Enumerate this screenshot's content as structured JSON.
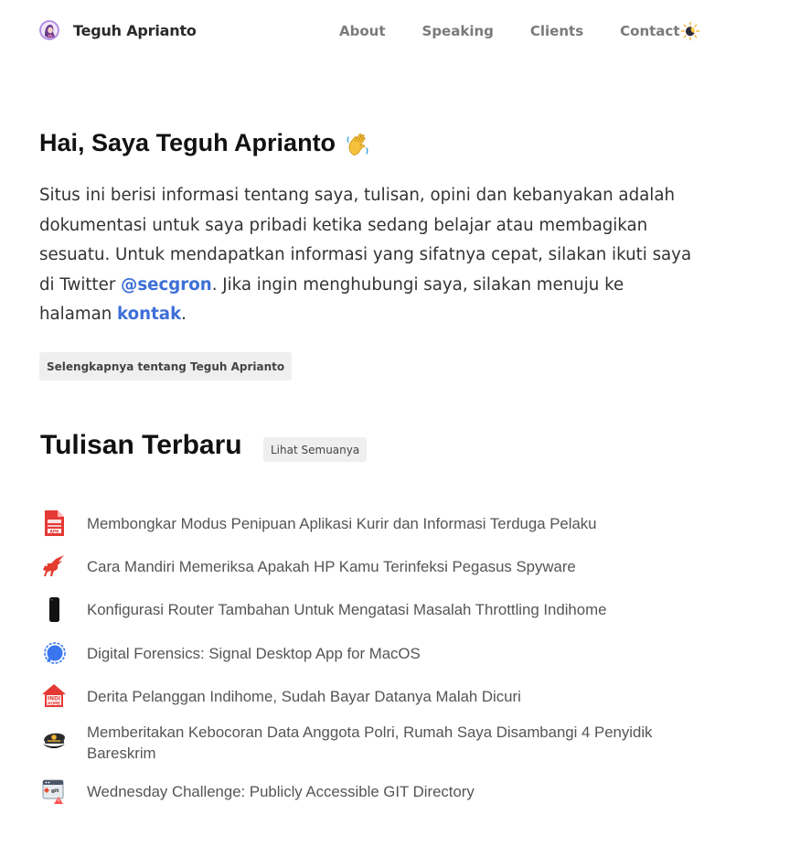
{
  "header": {
    "brand_name": "Teguh Aprianto",
    "nav": [
      "About",
      "Speaking",
      "Clients",
      "Contact"
    ]
  },
  "intro": {
    "title": "Hai, Saya Teguh Aprianto",
    "text_1": "Situs ini berisi informasi tentang saya, tulisan, opini dan kebanyakan adalah dokumentasi untuk saya pribadi ketika sedang belajar atau membagikan sesuatu. Untuk mendapatkan informasi yang sifatnya cepat, silakan ikuti saya di Twitter ",
    "twitter_link": "@secgron",
    "text_2": ". Jika ingin menghubungi saya, silakan menuju ke halaman ",
    "contact_link": "kontak",
    "text_3": ".",
    "more_button": "Selengkapnya tentang Teguh Aprianto"
  },
  "latest": {
    "title": "Tulisan Terbaru",
    "see_all": "Lihat Semuanya",
    "posts": [
      {
        "title": "Membongkar Modus Penipuan Aplikasi Kurir dan Informasi Terduga Pelaku",
        "icon": "apk-file-icon"
      },
      {
        "title": "Cara Mandiri Memeriksa Apakah HP Kamu Terinfeksi Pegasus Spyware",
        "icon": "pegasus-icon"
      },
      {
        "title": "Konfigurasi Router Tambahan Untuk Mengatasi Masalah Throttling Indihome",
        "icon": "router-icon"
      },
      {
        "title": "Digital Forensics: Signal Desktop App for MacOS",
        "icon": "signal-icon"
      },
      {
        "title": "Derita Pelanggan Indihome, Sudah Bayar Datanya Malah Dicuri",
        "icon": "indihome-icon"
      },
      {
        "title": "Memberitakan Kebocoran Data Anggota Polri, Rumah Saya Disambangi 4 Penyidik Bareskrim",
        "icon": "police-cap-icon"
      },
      {
        "title": "Wednesday Challenge: Publicly Accessible GIT Directory",
        "icon": "git-directory-icon"
      }
    ]
  }
}
